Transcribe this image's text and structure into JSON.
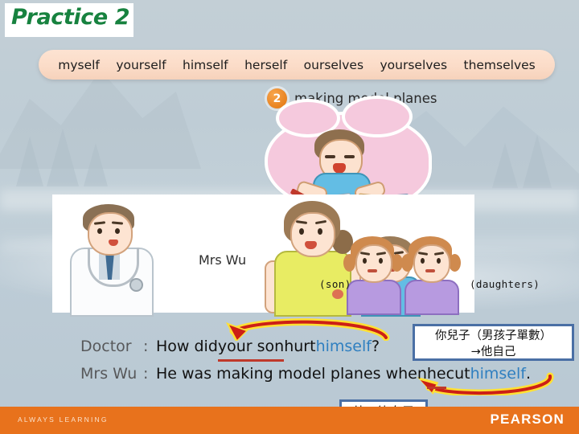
{
  "title": "Practice 2",
  "word_bank": [
    "myself",
    "yourself",
    "himself",
    "herself",
    "ourselves",
    "yourselves",
    "themselves"
  ],
  "item": {
    "number": "2",
    "label": "making model planes"
  },
  "illustration": {
    "mrs_wu_label": "Mrs Wu",
    "caption_son": "(son)",
    "caption_daughters": "(daughters)"
  },
  "dialogue": [
    {
      "speaker": "Doctor",
      "colon": ":",
      "pre": "How did ",
      "underlined": "your son",
      "mid": " hurt ",
      "reflexive": "himself",
      "post": "?"
    },
    {
      "speaker": "Mrs Wu",
      "colon": ":",
      "pre": "He was making model planes when ",
      "underlined": "he",
      "mid": " cut ",
      "reflexive": "himself",
      "post": "."
    }
  ],
  "notes": {
    "note_1_line_1": "你兒子（男孩子單數）",
    "note_1_line_2": "他自己",
    "note_1_arrow": "→",
    "note_2": "他→他自己"
  },
  "footer": {
    "tagline": "ALWAYS LEARNING",
    "brand": "PEARSON"
  },
  "colors": {
    "background": "#bfcdd6",
    "word_bank": "#fbdcc8",
    "title_green": "#17823f",
    "item_number_orange": "#e8821f",
    "reflexive_blue": "#2f7fc0",
    "underline_red": "#c0392b",
    "arrow_red": "#cc1f16",
    "arrow_glow_yellow": "#ffe033",
    "note_border_blue": "#4a6fa5",
    "footer_orange": "#e8721c"
  }
}
